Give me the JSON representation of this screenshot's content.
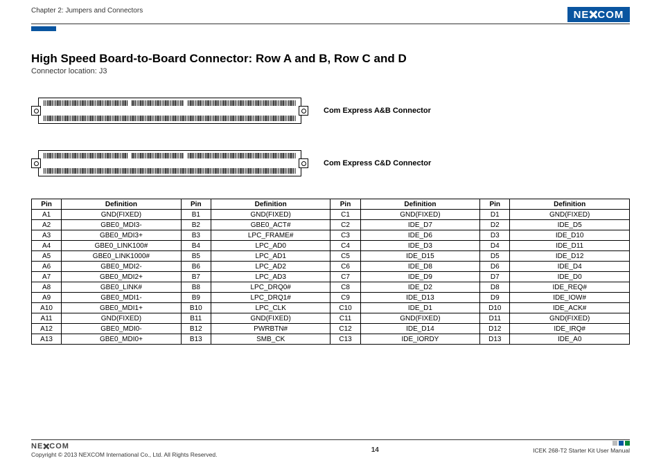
{
  "header": {
    "chapter": "Chapter 2: Jumpers and Connectors",
    "logo_text": "NEXCOM"
  },
  "title": "High Speed Board-to-Board Connector: Row A and B, Row C and D",
  "subtitle": "Connector location: J3",
  "connectors": {
    "ab_label": "Com Express A&B Connector",
    "cd_label": "Com Express C&D Connector"
  },
  "table": {
    "head": [
      "Pin",
      "Definition",
      "Pin",
      "Definition",
      "Pin",
      "Definition",
      "Pin",
      "Definition"
    ],
    "rows": [
      [
        "A1",
        "GND(FIXED)",
        "B1",
        "GND(FIXED)",
        "C1",
        "GND(FIXED)",
        "D1",
        "GND(FIXED)"
      ],
      [
        "A2",
        "GBE0_MDI3-",
        "B2",
        "GBE0_ACT#",
        "C2",
        "IDE_D7",
        "D2",
        "IDE_D5"
      ],
      [
        "A3",
        "GBE0_MDI3+",
        "B3",
        "LPC_FRAME#",
        "C3",
        "IDE_D6",
        "D3",
        "IDE_D10"
      ],
      [
        "A4",
        "GBE0_LINK100#",
        "B4",
        "LPC_AD0",
        "C4",
        "IDE_D3",
        "D4",
        "IDE_D11"
      ],
      [
        "A5",
        "GBE0_LINK1000#",
        "B5",
        "LPC_AD1",
        "C5",
        "IDE_D15",
        "D5",
        "IDE_D12"
      ],
      [
        "A6",
        "GBE0_MDI2-",
        "B6",
        "LPC_AD2",
        "C6",
        "IDE_D8",
        "D6",
        "IDE_D4"
      ],
      [
        "A7",
        "GBE0_MDI2+",
        "B7",
        "LPC_AD3",
        "C7",
        "IDE_D9",
        "D7",
        "IDE_D0"
      ],
      [
        "A8",
        "GBE0_LINK#",
        "B8",
        "LPC_DRQ0#",
        "C8",
        "IDE_D2",
        "D8",
        "IDE_REQ#"
      ],
      [
        "A9",
        "GBE0_MDI1-",
        "B9",
        "LPC_DRQ1#",
        "C9",
        "IDE_D13",
        "D9",
        "IDE_IOW#"
      ],
      [
        "A10",
        "GBE0_MDI1+",
        "B10",
        "LPC_CLK",
        "C10",
        "IDE_D1",
        "D10",
        "IDE_ACK#"
      ],
      [
        "A11",
        "GND(FIXED)",
        "B11",
        "GND(FIXED)",
        "C11",
        "GND(FIXED)",
        "D11",
        "GND(FIXED)"
      ],
      [
        "A12",
        "GBE0_MDI0-",
        "B12",
        "PWRBTN#",
        "C12",
        "IDE_D14",
        "D12",
        "IDE_IRQ#"
      ],
      [
        "A13",
        "GBE0_MDI0+",
        "B13",
        "SMB_CK",
        "C13",
        "IDE_IORDY",
        "D13",
        "IDE_A0"
      ]
    ]
  },
  "footer": {
    "copyright": "Copyright © 2013 NEXCOM International Co., Ltd. All Rights Reserved.",
    "page": "14",
    "manual": "ICEK 268-T2 Starter Kit User Manual"
  }
}
